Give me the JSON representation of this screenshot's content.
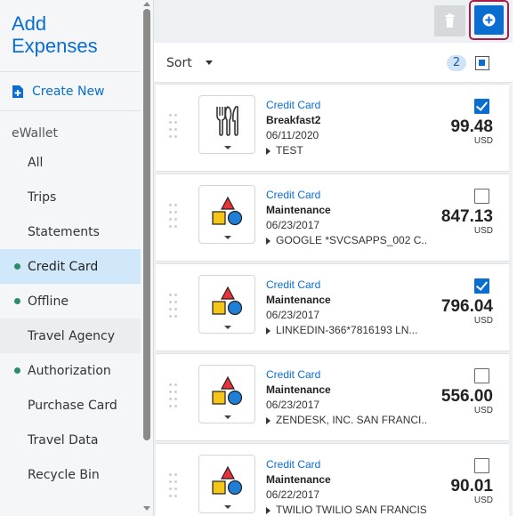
{
  "sidebar": {
    "title": "Add\nExpenses",
    "create_new": "Create New",
    "section": "eWallet",
    "items": [
      {
        "label": "All",
        "dot": false
      },
      {
        "label": "Trips",
        "dot": false
      },
      {
        "label": "Statements",
        "dot": false
      },
      {
        "label": "Credit Card",
        "dot": true,
        "selected": true
      },
      {
        "label": "Offline",
        "dot": true
      },
      {
        "label": "Travel Agency",
        "dot": false,
        "hover": true
      },
      {
        "label": "Authorization",
        "dot": true
      },
      {
        "label": "Purchase Card",
        "dot": false
      },
      {
        "label": "Travel Data",
        "dot": false
      },
      {
        "label": "Recycle Bin",
        "dot": false
      }
    ]
  },
  "toolbar": {
    "delete_icon": "trash-icon",
    "add_icon": "plus-circle-icon"
  },
  "sort": {
    "label": "Sort",
    "count": "2"
  },
  "colors": {
    "accent": "#0a6ed1",
    "dot": "#2c8c6a",
    "selected_bg": "#d1e8fb",
    "focus_ring": "#a51e4a"
  },
  "expenses": [
    {
      "type": "Credit Card",
      "name": "Breakfast2",
      "date": "06/11/2020",
      "merchant": "TEST",
      "amount": "99.48",
      "currency": "USD",
      "checked": true,
      "icon": "utensils-icon"
    },
    {
      "type": "Credit Card",
      "name": "Maintenance",
      "date": "06/23/2017",
      "merchant": "GOOGLE *SVCSAPPS_002 C...",
      "amount": "847.13",
      "currency": "USD",
      "checked": false,
      "icon": "shapes-icon"
    },
    {
      "type": "Credit Card",
      "name": "Maintenance",
      "date": "06/23/2017",
      "merchant": "LINKEDIN-366*7816193 LN...",
      "amount": "796.04",
      "currency": "USD",
      "checked": true,
      "icon": "shapes-icon"
    },
    {
      "type": "Credit Card",
      "name": "Maintenance",
      "date": "06/23/2017",
      "merchant": "ZENDESK, INC. SAN FRANCI...",
      "amount": "556.00",
      "currency": "USD",
      "checked": false,
      "icon": "shapes-icon"
    },
    {
      "type": "Credit Card",
      "name": "Maintenance",
      "date": "06/22/2017",
      "merchant": "TWILIO TWILIO SAN FRANCIS...",
      "amount": "90.01",
      "currency": "USD",
      "checked": false,
      "icon": "shapes-icon"
    }
  ]
}
